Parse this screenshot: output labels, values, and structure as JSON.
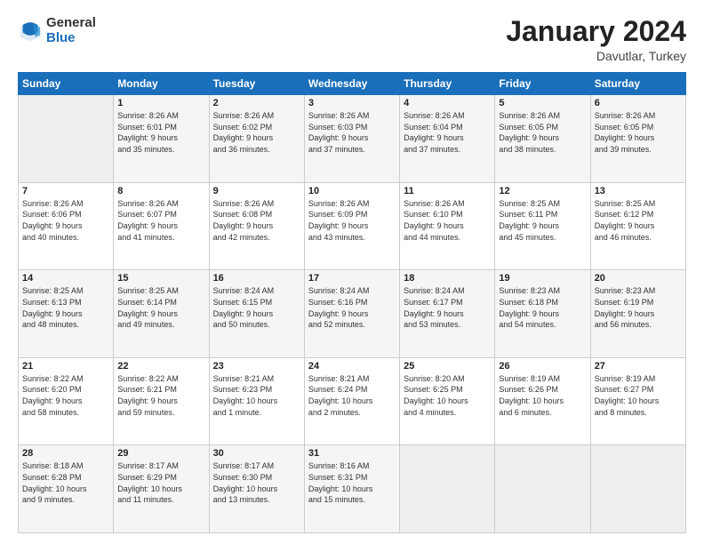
{
  "header": {
    "logo_general": "General",
    "logo_blue": "Blue",
    "month_title": "January 2024",
    "location": "Davutlar, Turkey"
  },
  "days_of_week": [
    "Sunday",
    "Monday",
    "Tuesday",
    "Wednesday",
    "Thursday",
    "Friday",
    "Saturday"
  ],
  "weeks": [
    [
      {
        "num": "",
        "info": ""
      },
      {
        "num": "1",
        "info": "Sunrise: 8:26 AM\nSunset: 6:01 PM\nDaylight: 9 hours\nand 35 minutes."
      },
      {
        "num": "2",
        "info": "Sunrise: 8:26 AM\nSunset: 6:02 PM\nDaylight: 9 hours\nand 36 minutes."
      },
      {
        "num": "3",
        "info": "Sunrise: 8:26 AM\nSunset: 6:03 PM\nDaylight: 9 hours\nand 37 minutes."
      },
      {
        "num": "4",
        "info": "Sunrise: 8:26 AM\nSunset: 6:04 PM\nDaylight: 9 hours\nand 37 minutes."
      },
      {
        "num": "5",
        "info": "Sunrise: 8:26 AM\nSunset: 6:05 PM\nDaylight: 9 hours\nand 38 minutes."
      },
      {
        "num": "6",
        "info": "Sunrise: 8:26 AM\nSunset: 6:05 PM\nDaylight: 9 hours\nand 39 minutes."
      }
    ],
    [
      {
        "num": "7",
        "info": "Sunrise: 8:26 AM\nSunset: 6:06 PM\nDaylight: 9 hours\nand 40 minutes."
      },
      {
        "num": "8",
        "info": "Sunrise: 8:26 AM\nSunset: 6:07 PM\nDaylight: 9 hours\nand 41 minutes."
      },
      {
        "num": "9",
        "info": "Sunrise: 8:26 AM\nSunset: 6:08 PM\nDaylight: 9 hours\nand 42 minutes."
      },
      {
        "num": "10",
        "info": "Sunrise: 8:26 AM\nSunset: 6:09 PM\nDaylight: 9 hours\nand 43 minutes."
      },
      {
        "num": "11",
        "info": "Sunrise: 8:26 AM\nSunset: 6:10 PM\nDaylight: 9 hours\nand 44 minutes."
      },
      {
        "num": "12",
        "info": "Sunrise: 8:25 AM\nSunset: 6:11 PM\nDaylight: 9 hours\nand 45 minutes."
      },
      {
        "num": "13",
        "info": "Sunrise: 8:25 AM\nSunset: 6:12 PM\nDaylight: 9 hours\nand 46 minutes."
      }
    ],
    [
      {
        "num": "14",
        "info": "Sunrise: 8:25 AM\nSunset: 6:13 PM\nDaylight: 9 hours\nand 48 minutes."
      },
      {
        "num": "15",
        "info": "Sunrise: 8:25 AM\nSunset: 6:14 PM\nDaylight: 9 hours\nand 49 minutes."
      },
      {
        "num": "16",
        "info": "Sunrise: 8:24 AM\nSunset: 6:15 PM\nDaylight: 9 hours\nand 50 minutes."
      },
      {
        "num": "17",
        "info": "Sunrise: 8:24 AM\nSunset: 6:16 PM\nDaylight: 9 hours\nand 52 minutes."
      },
      {
        "num": "18",
        "info": "Sunrise: 8:24 AM\nSunset: 6:17 PM\nDaylight: 9 hours\nand 53 minutes."
      },
      {
        "num": "19",
        "info": "Sunrise: 8:23 AM\nSunset: 6:18 PM\nDaylight: 9 hours\nand 54 minutes."
      },
      {
        "num": "20",
        "info": "Sunrise: 8:23 AM\nSunset: 6:19 PM\nDaylight: 9 hours\nand 56 minutes."
      }
    ],
    [
      {
        "num": "21",
        "info": "Sunrise: 8:22 AM\nSunset: 6:20 PM\nDaylight: 9 hours\nand 58 minutes."
      },
      {
        "num": "22",
        "info": "Sunrise: 8:22 AM\nSunset: 6:21 PM\nDaylight: 9 hours\nand 59 minutes."
      },
      {
        "num": "23",
        "info": "Sunrise: 8:21 AM\nSunset: 6:23 PM\nDaylight: 10 hours\nand 1 minute."
      },
      {
        "num": "24",
        "info": "Sunrise: 8:21 AM\nSunset: 6:24 PM\nDaylight: 10 hours\nand 2 minutes."
      },
      {
        "num": "25",
        "info": "Sunrise: 8:20 AM\nSunset: 6:25 PM\nDaylight: 10 hours\nand 4 minutes."
      },
      {
        "num": "26",
        "info": "Sunrise: 8:19 AM\nSunset: 6:26 PM\nDaylight: 10 hours\nand 6 minutes."
      },
      {
        "num": "27",
        "info": "Sunrise: 8:19 AM\nSunset: 6:27 PM\nDaylight: 10 hours\nand 8 minutes."
      }
    ],
    [
      {
        "num": "28",
        "info": "Sunrise: 8:18 AM\nSunset: 6:28 PM\nDaylight: 10 hours\nand 9 minutes."
      },
      {
        "num": "29",
        "info": "Sunrise: 8:17 AM\nSunset: 6:29 PM\nDaylight: 10 hours\nand 11 minutes."
      },
      {
        "num": "30",
        "info": "Sunrise: 8:17 AM\nSunset: 6:30 PM\nDaylight: 10 hours\nand 13 minutes."
      },
      {
        "num": "31",
        "info": "Sunrise: 8:16 AM\nSunset: 6:31 PM\nDaylight: 10 hours\nand 15 minutes."
      },
      {
        "num": "",
        "info": ""
      },
      {
        "num": "",
        "info": ""
      },
      {
        "num": "",
        "info": ""
      }
    ]
  ]
}
